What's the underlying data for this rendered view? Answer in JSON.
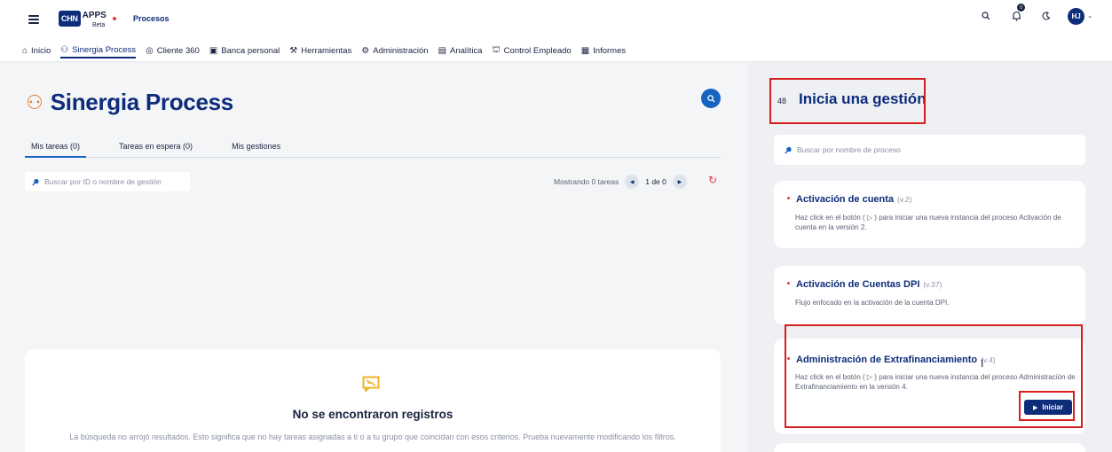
{
  "header": {
    "logo_text": "CHN",
    "app_name": "APPS",
    "beta": "Beta",
    "breadcrumb": "Procesos",
    "notifications_count": "0",
    "user_initials": "HJ"
  },
  "nav": {
    "items": [
      {
        "label": "Inicio",
        "icon": "home-icon"
      },
      {
        "label": "Sinergia Process",
        "icon": "process-icon",
        "active": true
      },
      {
        "label": "Cliente 360",
        "icon": "target-icon"
      },
      {
        "label": "Banca personal",
        "icon": "card-icon"
      },
      {
        "label": "Herramientas",
        "icon": "tools-icon"
      },
      {
        "label": "Administración",
        "icon": "gear-icon"
      },
      {
        "label": "Analítica",
        "icon": "chart-icon"
      },
      {
        "label": "Control Empleado",
        "icon": "employee-icon"
      },
      {
        "label": "Informes",
        "icon": "report-icon"
      }
    ]
  },
  "main": {
    "title": "Sinergia Process",
    "tabs": [
      "Mis tareas (0)",
      "Tareas en espera (0)",
      "Mis gestiones"
    ],
    "search_placeholder": "Buscar por ID o nombre de gestión",
    "pager_label": "Mostrando 0 tareas",
    "pager_page": "1 de 0",
    "empty_title": "No se encontraron registros",
    "empty_desc": "La búsqueda no arrojó resultados. Esto significa que no hay tareas asignadas a ti o a tu grupo que coincidan con esos criterios. Prueba nuevamente modificando los filtros."
  },
  "right": {
    "count": "48",
    "title": "Inicia una gestión",
    "search_placeholder": "Buscar por nombre de proceso",
    "processes": [
      {
        "name": "Activación de cuenta",
        "version": "(v.2)",
        "desc": "Haz click en el botón ( ▷ ) para iniciar una nueva instancia del proceso Activación de cuenta en la versión 2."
      },
      {
        "name": "Activación de Cuentas DPI",
        "version": "(v.37)",
        "desc": "Flujo enfocado en la activación de la cuenta DPI."
      },
      {
        "name": "Administración de Extrafinanciamiento",
        "version": "(v.4)",
        "desc": "Haz click en el botón ( ▷ ) para iniciar una nueva instancia del proceso Administración de Extrafinanciamiento en la versión 4."
      }
    ],
    "start_button": "Iniciar"
  },
  "colors": {
    "brand": "#0d2c7a",
    "accent": "#1565c0",
    "highlight": "#d61f1f",
    "orange": "#e8782d"
  }
}
